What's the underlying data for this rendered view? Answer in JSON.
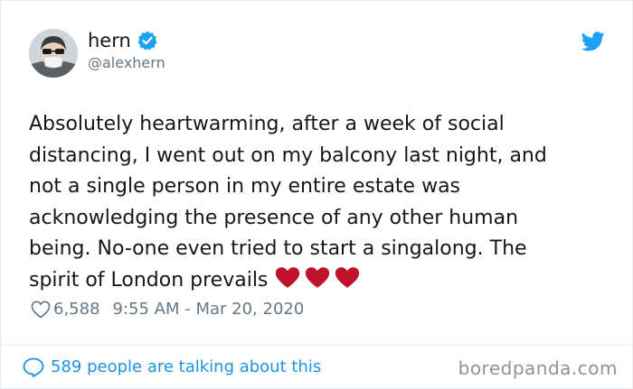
{
  "author": {
    "display_name": "hern",
    "handle": "@alexhern",
    "verified": true
  },
  "tweet": {
    "text": "Absolutely heartwarming, after a week of social\ndistancing, I went out on my balcony last night, and\nnot a single person in my entire estate was\nacknowledging the presence of any other human\nbeing. No-one even tried to start a singalong. The\nspirit of London prevails",
    "emoji": [
      "red-heart",
      "red-heart",
      "red-heart"
    ]
  },
  "meta": {
    "likes": "6,588",
    "timestamp": "9:55 AM - Mar 20, 2020"
  },
  "footer": {
    "conversation_text": "589 people are talking about this",
    "watermark": "boredpanda.com"
  },
  "colors": {
    "accent": "#1da1f2",
    "link": "#1b95e0",
    "heart": "#c0132b",
    "muted": "#657786"
  }
}
